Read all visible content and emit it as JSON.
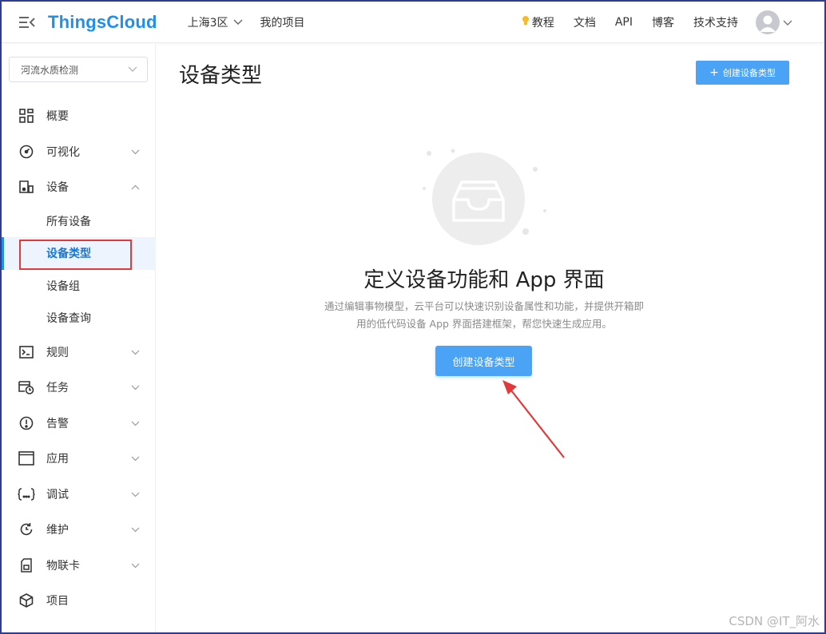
{
  "topbar": {
    "logo": "ThingsCloud",
    "region": "上海3区",
    "projects": "我的项目",
    "nav": [
      {
        "label": "教程",
        "icon": "bulb-icon"
      },
      {
        "label": "文档"
      },
      {
        "label": "API"
      },
      {
        "label": "博客"
      },
      {
        "label": "技术支持"
      }
    ]
  },
  "sidebar": {
    "project_select": "河流水质检测",
    "items": [
      {
        "label": "概要",
        "icon": "grid-icon"
      },
      {
        "label": "可视化",
        "icon": "dashboard-icon"
      },
      {
        "label": "设备",
        "icon": "device-icon"
      },
      {
        "label": "规则",
        "icon": "terminal-icon"
      },
      {
        "label": "任务",
        "icon": "task-clock-icon"
      },
      {
        "label": "告警",
        "icon": "alert-icon"
      },
      {
        "label": "应用",
        "icon": "window-icon"
      },
      {
        "label": "调试",
        "icon": "braces-icon"
      },
      {
        "label": "维护",
        "icon": "refresh-icon"
      },
      {
        "label": "物联卡",
        "icon": "sim-card-icon"
      },
      {
        "label": "项目",
        "icon": "cube-icon"
      }
    ],
    "device_sub": [
      {
        "label": "所有设备"
      },
      {
        "label": "设备类型",
        "active": true
      },
      {
        "label": "设备组"
      },
      {
        "label": "设备查询"
      }
    ]
  },
  "main": {
    "title": "设备类型",
    "top_button": "创建设备类型",
    "empty": {
      "title": "定义设备功能和 App 界面",
      "desc_line1": "通过编辑事物模型，云平台可以快速识别设备属性和功能，并提供开箱即",
      "desc_line2": "用的低代码设备 App 界面搭建框架，帮您快速生成应用。",
      "button": "创建设备类型"
    }
  },
  "watermark": "CSDN @IT_阿水",
  "colors": {
    "brand": "#1f8fea",
    "button": "#4aa3f5",
    "annotation": "#e23a3a"
  }
}
